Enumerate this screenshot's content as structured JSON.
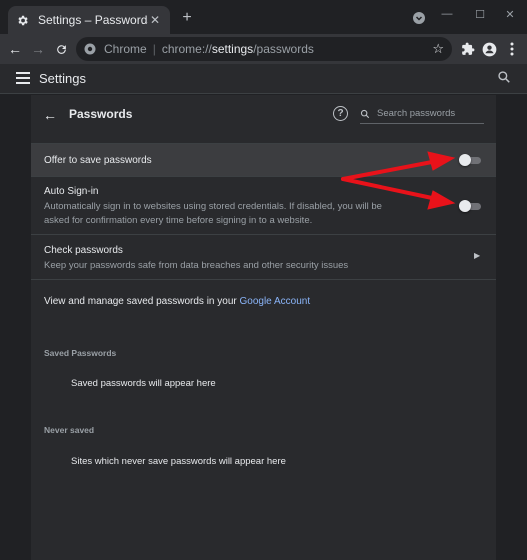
{
  "browser": {
    "tab_title": "Settings – Passwords",
    "omnibox_chip": "Chrome",
    "omnibox_url_prefix": "chrome://",
    "omnibox_url_host": "settings",
    "omnibox_url_path": "/passwords",
    "omnibox_separator": "|"
  },
  "appbar": {
    "title": "Settings"
  },
  "passwords_page": {
    "title": "Passwords",
    "search_placeholder": "Search passwords"
  },
  "rows": {
    "offer_to_save": {
      "title": "Offer to save passwords",
      "enabled": false
    },
    "auto_signin": {
      "title": "Auto Sign-in",
      "subtitle": "Automatically sign in to websites using stored credentials. If disabled, you will be asked for confirmation every time before signing in to a website.",
      "enabled": false
    },
    "check_passwords": {
      "title": "Check passwords",
      "subtitle": "Keep your passwords safe from data breaches and other security issues"
    },
    "manage": {
      "text": "View and manage saved passwords in your",
      "link": "Google Account"
    }
  },
  "sections": {
    "saved": {
      "title": "Saved Passwords",
      "empty": "Saved passwords will appear here"
    },
    "never": {
      "title": "Never saved",
      "empty": "Sites which never save passwords will appear here"
    }
  },
  "icons": {
    "tab": "gear-icon",
    "tab_close": "close-icon",
    "new_tab": "plus-icon",
    "profile_menu": "chevron-down-icon",
    "back": "arrow-left-icon",
    "forward": "arrow-right-icon",
    "reload": "reload-icon",
    "site_info": "chrome-logo-icon",
    "bookmark": "star-icon",
    "extensions": "puzzle-icon",
    "profile": "person-icon",
    "menu": "more-vert-icon",
    "hamburger": "menu-icon",
    "settings_search": "search-icon",
    "page_back": "arrow-left-icon",
    "help": "help-icon",
    "password_search": "search-icon",
    "check_chevron": "chevron-right-icon",
    "annotation_arrows": "red-arrow-icon"
  },
  "colors": {
    "background": "#202124",
    "card": "#292a2d",
    "toolbar": "#35363a",
    "link": "#8ab4f8",
    "annotation": "#e8121a"
  }
}
